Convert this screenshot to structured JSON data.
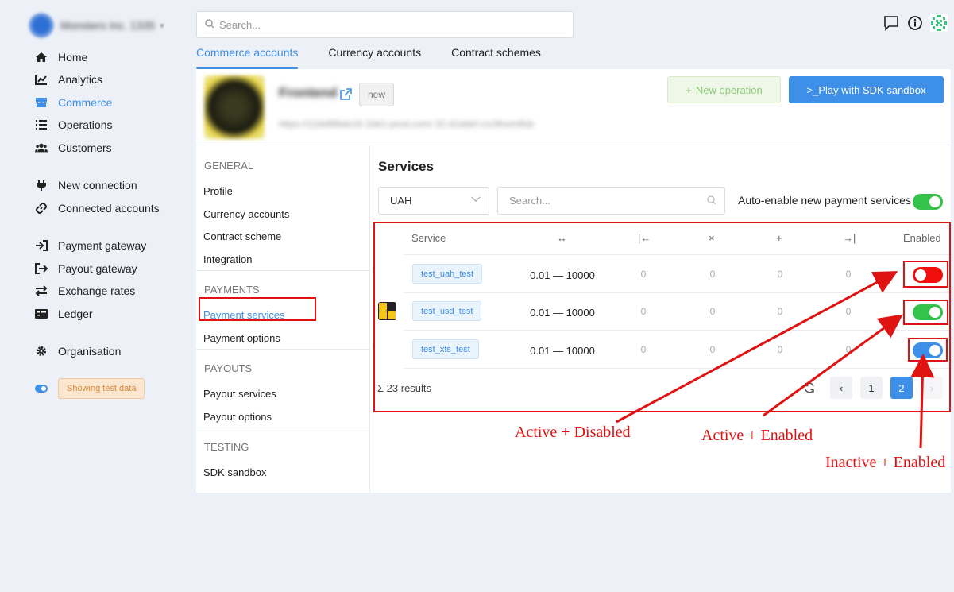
{
  "org": {
    "name": "Monsters Inc. 1335"
  },
  "sidebar": {
    "items": [
      {
        "label": "Home"
      },
      {
        "label": "Analytics"
      },
      {
        "label": "Commerce"
      },
      {
        "label": "Operations"
      },
      {
        "label": "Customers"
      },
      {
        "label": "New connection"
      },
      {
        "label": "Connected accounts"
      },
      {
        "label": "Payment gateway"
      },
      {
        "label": "Payout gateway"
      },
      {
        "label": "Exchange rates"
      },
      {
        "label": "Ledger"
      },
      {
        "label": "Organisation"
      }
    ],
    "test_badge": "Showing test data"
  },
  "search": {
    "placeholder": "Search..."
  },
  "tabs": [
    {
      "label": "Commerce accounts"
    },
    {
      "label": "Currency accounts"
    },
    {
      "label": "Contract schemes"
    }
  ],
  "account": {
    "name": "Frontend",
    "badge": "new",
    "url": "https://11bbf86de16-1bb1-prod.com/.32.d1ddef.rzs3foxmtfsb",
    "new_operation_label": "New operation",
    "sdk_label": "Play with SDK sandbox"
  },
  "settings_nav": {
    "general_title": "GENERAL",
    "general": [
      "Profile",
      "Currency accounts",
      "Contract scheme",
      "Integration"
    ],
    "payments_title": "PAYMENTS",
    "payments": [
      "Payment services",
      "Payment options"
    ],
    "payouts_title": "PAYOUTS",
    "payouts": [
      "Payout services",
      "Payout options"
    ],
    "testing_title": "TESTING",
    "testing": [
      "SDK sandbox"
    ]
  },
  "services": {
    "title": "Services",
    "currency": "UAH",
    "search_placeholder": "Search...",
    "auto_enable_label": "Auto-enable new payment services",
    "columns": {
      "service": "Service",
      "range": "↔",
      "min": "|←",
      "fee": "×",
      "fixed": "+",
      "max": "→|",
      "enabled": "Enabled"
    },
    "rows": [
      {
        "name": "test_uah_test",
        "range": "0.01 — 10000",
        "v1": "0",
        "v2": "0",
        "v3": "0",
        "v4": "0",
        "enabled_state": "active-disabled"
      },
      {
        "name": "test_usd_test",
        "range": "0.01 — 10000",
        "v1": "0",
        "v2": "0",
        "v3": "0",
        "v4": "0",
        "enabled_state": "active-enabled"
      },
      {
        "name": "test_xts_test",
        "range": "0.01 — 10000",
        "v1": "0",
        "v2": "0",
        "v3": "0",
        "v4": "0",
        "enabled_state": "inactive-enabled"
      }
    ],
    "results": "23 results",
    "results_symbol": "Σ",
    "pages": [
      "1",
      "2"
    ],
    "current_page": "2"
  },
  "annotations": {
    "active_disabled": "Active + Disabled",
    "active_enabled": "Active + Enabled",
    "inactive_enabled": "Inactive + Enabled"
  },
  "colors": {
    "accent": "#3d8fe8",
    "green": "#34c24a",
    "red": "#f20d0d",
    "annotation": "#e01313"
  }
}
